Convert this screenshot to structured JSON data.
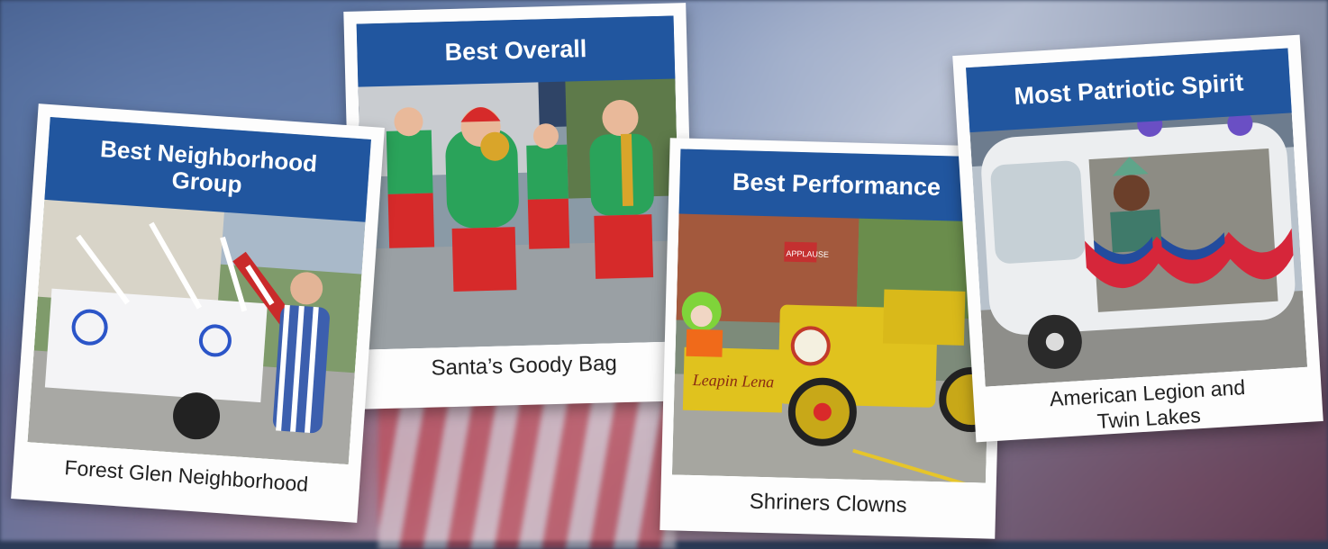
{
  "awards": [
    {
      "title": "Best Neighborhood Group",
      "title_line1": "Best Neighborhood",
      "title_line2": "Group",
      "winner": "Forest Glen Neighborhood"
    },
    {
      "title": "Best Overall",
      "winner": "Santa’s Goody Bag"
    },
    {
      "title": "Best Performance",
      "winner": "Shriners Clowns"
    },
    {
      "title": "Most Patriotic Spirit",
      "winner": "American Legion and Twin Lakes",
      "winner_line1": "American Legion and",
      "winner_line2": "Twin Lakes"
    }
  ],
  "photo_signs": {
    "vehicle_sign": "Leapin Lena",
    "card_sign": "APPLAUSE"
  },
  "colors": {
    "banner": "#21569f",
    "card": "#fdfdfd"
  }
}
